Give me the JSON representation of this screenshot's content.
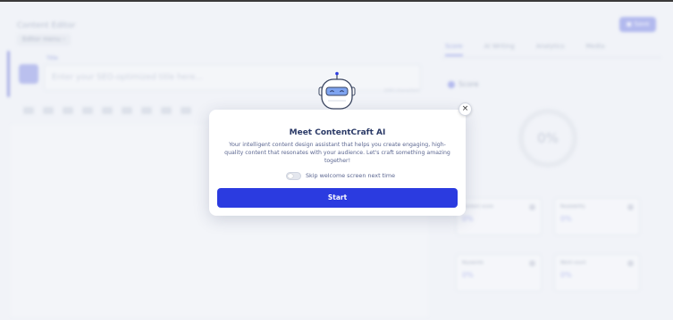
{
  "editor": {
    "title": "Content Editor",
    "menu_label": "Editor menu",
    "save_label": "Save",
    "title_field": {
      "label": "Title",
      "placeholder": "Enter your SEO-optimized title here...",
      "counter": "0/60 characters"
    }
  },
  "right_panel": {
    "tabs": [
      {
        "label": "Score",
        "active": true
      },
      {
        "label": "AI Writing",
        "active": false
      },
      {
        "label": "Analytics",
        "active": false
      },
      {
        "label": "Media",
        "active": false
      }
    ],
    "score_label": "Score",
    "score_value": "0%",
    "metrics": [
      {
        "label": "Content score",
        "value": "0%"
      },
      {
        "label": "Readability",
        "value": "0%"
      },
      {
        "label": "Keywords",
        "value": "0%"
      },
      {
        "label": "Word count",
        "value": "0%"
      }
    ]
  },
  "modal": {
    "title": "Meet ContentCraft AI",
    "description": "Your intelligent content design assistant that helps you create engaging, high-quality content that resonates with your audience. Let's craft something amazing together!",
    "skip_label": "Skip welcome screen next time",
    "skip_checked": false,
    "start_label": "Start",
    "close_symbol": "×"
  },
  "colors": {
    "primary": "#2b3be0",
    "title": "#2b3a67",
    "text": "#5b6690",
    "robot_visor": "#7fa4f0"
  },
  "icons": [
    "robot-icon",
    "close-icon",
    "save-icon",
    "bot-logo-icon"
  ]
}
